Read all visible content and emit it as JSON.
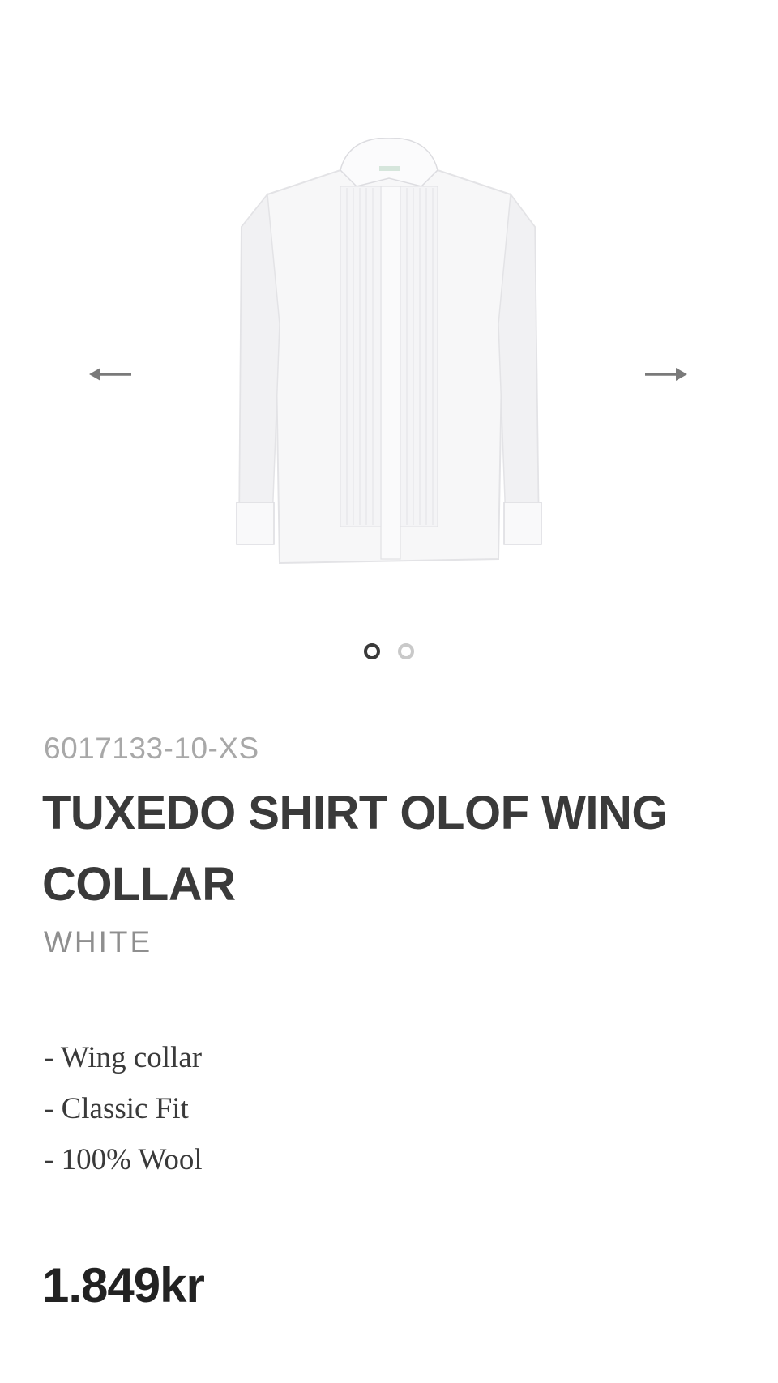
{
  "gallery": {
    "prev_icon": "arrow-left-icon",
    "next_icon": "arrow-right-icon",
    "image_alt": "Tuxedo shirt",
    "dots": [
      {
        "state": "active"
      },
      {
        "state": "inactive"
      }
    ]
  },
  "product": {
    "sku": "6017133-10-XS",
    "title": "TUXEDO SHIRT OLOF WING COLLAR",
    "color": "WHITE",
    "features": [
      "- Wing collar",
      "- Classic Fit",
      "- 100% Wool"
    ],
    "price": "1.849kr"
  },
  "colors": {
    "text": "#3a3a3a",
    "muted": "#a8a8a8",
    "dot_inactive": "#c9c9c9"
  }
}
